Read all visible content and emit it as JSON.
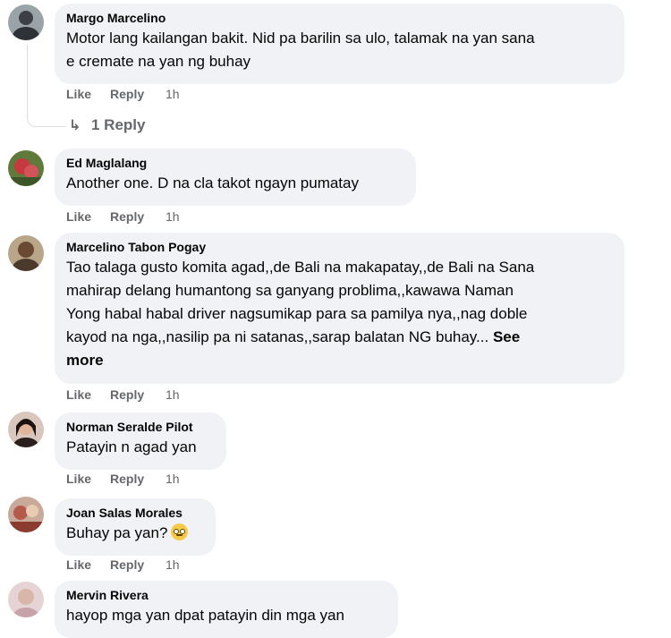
{
  "actions": {
    "like": "Like",
    "reply": "Reply"
  },
  "comments": [
    {
      "author": "Margo Marcelino",
      "lines": [
        "Motor lang kailangan bakit. Nid pa barilin sa ulo, talamak na yan sana",
        "e cremate na yan ng buhay"
      ],
      "time": "1h",
      "replies": "1 Reply"
    },
    {
      "author": "Ed Maglalang",
      "lines": [
        "Another one. D na cla takot ngayn pumatay"
      ],
      "time": "1h"
    },
    {
      "author": "Marcelino Tabon Pogay",
      "lines": [
        "Tao talaga gusto komita agad,,de Bali na makapatay,,de Bali na Sana",
        "mahirap delang humantong sa ganyang problima,,kawawa Naman",
        "Yong habal habal driver nagsumikap para sa pamilya nya,,nag doble",
        "kayod na nga,,nasilip pa ni satanas,,sarap balatan NG buhay..."
      ],
      "see_more_1": "See",
      "see_more_2": "more",
      "time": "1h"
    },
    {
      "author": "Norman Seralde Pilot",
      "lines": [
        "Patayin n agad yan"
      ],
      "time": "1h"
    },
    {
      "author": "Joan Salas Morales",
      "lines": [
        "Buhay pa yan?"
      ],
      "emoji": "face-with-rolling-eyes-emoji",
      "time": "1h"
    },
    {
      "author": "Mervin Rivera",
      "lines": [
        "hayop mga yan dpat patayin din mga yan"
      ]
    }
  ]
}
